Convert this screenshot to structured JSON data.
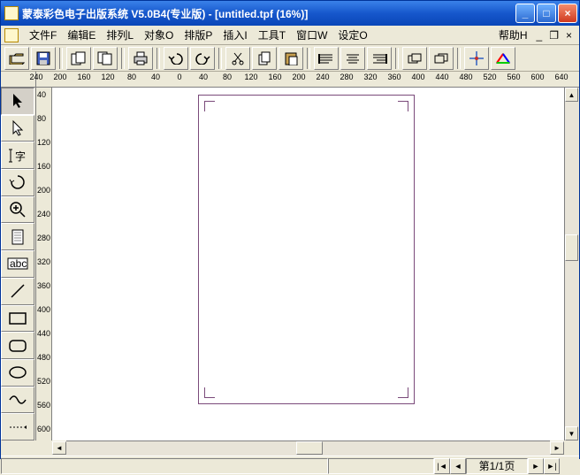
{
  "window": {
    "title": "蒙泰彩色电子出版系统 V5.0B4(专业版) - [untitled.tpf (16%)]"
  },
  "menu": {
    "file": "文件F",
    "edit": "编辑E",
    "arrange": "排列L",
    "object": "对象O",
    "layout": "排版P",
    "insert": "插入I",
    "tools": "工具T",
    "window": "窗口W",
    "settings": "设定O",
    "help": "帮助H"
  },
  "ruler_h": [
    "240",
    "200",
    "160",
    "120",
    "80",
    "40",
    "0",
    "40",
    "80",
    "120",
    "160",
    "200",
    "240",
    "280",
    "320",
    "360",
    "400",
    "440",
    "480",
    "520",
    "560",
    "600",
    "640"
  ],
  "ruler_v": [
    "40",
    "80",
    "120",
    "160",
    "200",
    "240",
    "280",
    "320",
    "360",
    "400",
    "440",
    "480",
    "520",
    "560",
    "600"
  ],
  "status": {
    "page": "第1/1页"
  },
  "toolbar": {
    "open": "open",
    "save": "save",
    "copy_page": "copy-page",
    "paste_page": "paste-page",
    "print": "print",
    "undo": "undo",
    "redo": "redo",
    "cut": "cut",
    "copy": "copy",
    "paste": "paste",
    "align1": "align",
    "align2": "align",
    "align3": "align",
    "group1": "group",
    "group2": "group",
    "move": "move",
    "color": "color"
  },
  "tools": {
    "pointer": "pointer",
    "select": "select",
    "text": "text",
    "rotate": "rotate",
    "zoom": "zoom",
    "page": "page",
    "textbox": "textbox",
    "line": "line",
    "rect": "rect",
    "roundrect": "roundrect",
    "ellipse": "ellipse",
    "curve": "curve",
    "pen": "pen"
  }
}
